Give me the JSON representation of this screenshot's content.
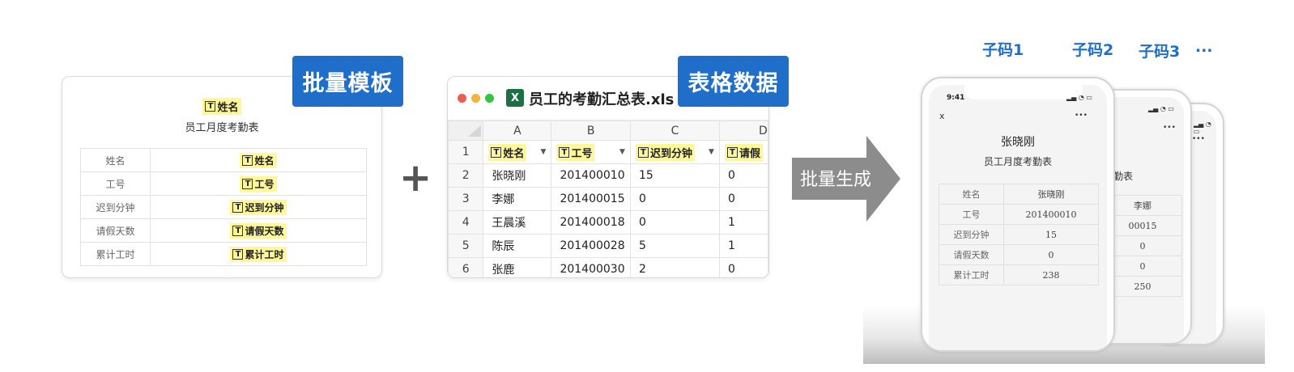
{
  "template_card": {
    "tag": "批量模板",
    "title_chip": "姓名",
    "t_glyph": "T",
    "subtitle": "员工月度考勤表",
    "rows": [
      {
        "label": "姓名",
        "value": "姓名"
      },
      {
        "label": "工号",
        "value": "工号"
      },
      {
        "label": "迟到分钟",
        "value": "迟到分钟"
      },
      {
        "label": "请假天数",
        "value": "请假天数"
      },
      {
        "label": "累计工时",
        "value": "累计工时"
      }
    ]
  },
  "plus_sign": "+",
  "spreadsheet": {
    "tag": "表格数据",
    "title": "员工的考勤汇总表.xls",
    "file_icon": "X",
    "columns": [
      "A",
      "B",
      "C",
      "D"
    ],
    "header_row": {
      "num": "1",
      "cells": [
        "姓名",
        "工号",
        "迟到分钟",
        "请假"
      ]
    },
    "rows": [
      {
        "num": "2",
        "cells": [
          "张晓刚",
          "201400010",
          "15",
          "0"
        ]
      },
      {
        "num": "3",
        "cells": [
          "李娜",
          "201400015",
          "0",
          "0"
        ]
      },
      {
        "num": "4",
        "cells": [
          "王晨溪",
          "201400018",
          "0",
          "1"
        ]
      },
      {
        "num": "5",
        "cells": [
          "陈辰",
          "201400028",
          "5",
          "1"
        ]
      },
      {
        "num": "6",
        "cells": [
          "张鹿",
          "201400030",
          "2",
          "0"
        ]
      }
    ],
    "traffic_light_colors": [
      "#ee5c54",
      "#f6b33b",
      "#37c33f"
    ]
  },
  "arrow": {
    "label": "批量生成",
    "color": "#8c8c8c"
  },
  "codes": {
    "c1": "子码1",
    "c2": "子码2",
    "c3": "子码3",
    "more": "..."
  },
  "phone_front": {
    "time": "9:41",
    "close": "x",
    "menu": "•••",
    "name": "张晓刚",
    "subtitle": "员工月度考勤表",
    "rows": [
      {
        "label": "姓名",
        "value": "张晓刚"
      },
      {
        "label": "工号",
        "value": "201400010"
      },
      {
        "label": "迟到分钟",
        "value": "15"
      },
      {
        "label": "请假天数",
        "value": "0"
      },
      {
        "label": "累计工时",
        "value": "238"
      }
    ]
  },
  "phone_middle": {
    "menu": "•••",
    "subtitle_fragment": "勤表",
    "values": [
      "李娜",
      "00015",
      "0",
      "0",
      "250"
    ]
  },
  "phone_back": {
    "menu": "•••"
  },
  "accent_color": "#1f6ec9",
  "highlight_color": "#fff89a"
}
